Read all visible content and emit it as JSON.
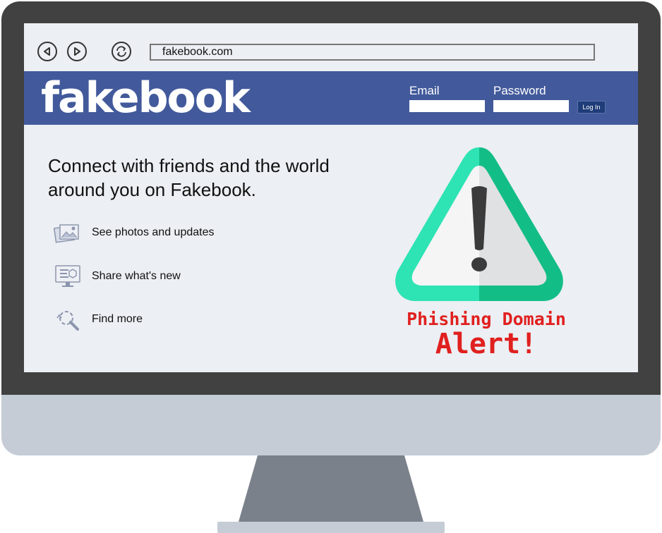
{
  "browser": {
    "address": "fakebook.com",
    "icons": [
      "back-arrow-icon",
      "forward-arrow-icon",
      "reload-icon"
    ]
  },
  "site": {
    "logo": "fakebook",
    "brand_color": "#425a9b",
    "email_label": "Email",
    "email_value": "",
    "password_label": "Password",
    "password_value": "",
    "login_label": "Log In"
  },
  "main": {
    "headline": "Connect with friends and the world around you on Fakebook.",
    "features": [
      {
        "label": "See photos and updates",
        "icon": "photos-icon"
      },
      {
        "label": "Share what's new",
        "icon": "monitor-icon"
      },
      {
        "label": "Find more",
        "icon": "search-icon"
      }
    ]
  },
  "alert": {
    "line1": "Phishing Domain",
    "line2": "Alert!",
    "color": "#e0201f",
    "icon": "warning-triangle-icon"
  }
}
